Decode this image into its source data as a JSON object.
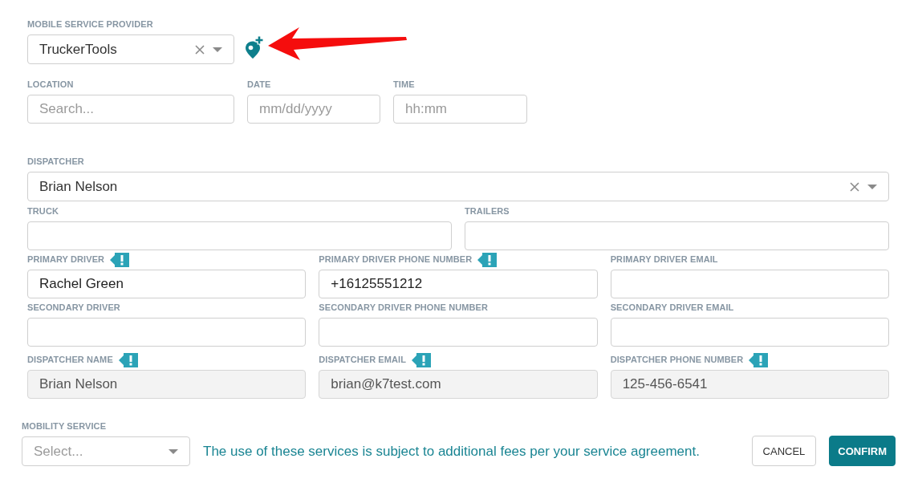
{
  "provider": {
    "label": "MOBILE SERVICE PROVIDER",
    "value": "TruckerTools",
    "clearable": true
  },
  "schedule": [
    {
      "label": "LOCATION",
      "placeholder": "Search..."
    },
    {
      "label": "DATE",
      "placeholder": "mm/dd/yyyy"
    },
    {
      "label": "TIME",
      "placeholder": "hh:mm"
    }
  ],
  "dispatcher": {
    "label": "DISPATCHER",
    "value": "Brian Nelson",
    "clearable": true
  },
  "vehicles": [
    {
      "label": "TRUCK"
    },
    {
      "label": "TRAILERS"
    }
  ],
  "driver_rows": [
    {
      "fields": [
        {
          "label": "PRIMARY DRIVER",
          "value": "Rachel Green",
          "flagged": true,
          "disabled": false
        },
        {
          "label": "PRIMARY DRIVER PHONE NUMBER",
          "value": "+16125551212",
          "flagged": true,
          "disabled": false
        },
        {
          "label": "PRIMARY DRIVER EMAIL",
          "flagged": false,
          "disabled": false
        }
      ]
    },
    {
      "fields": [
        {
          "label": "SECONDARY DRIVER",
          "flagged": false,
          "disabled": false
        },
        {
          "label": "SECONDARY DRIVER PHONE NUMBER",
          "flagged": false,
          "disabled": false
        },
        {
          "label": "SECONDARY DRIVER EMAIL",
          "flagged": false,
          "disabled": false
        }
      ]
    }
  ],
  "dispatcher_contact": [
    {
      "label": "DISPATCHER NAME",
      "value": "Brian Nelson",
      "flagged": true,
      "disabled": true
    },
    {
      "label": "DISPATCHER EMAIL",
      "value": "brian@k7test.com",
      "flagged": true,
      "disabled": true
    },
    {
      "label": "DISPATCHER PHONE NUMBER",
      "value": "125-456-6541",
      "flagged": true,
      "disabled": true
    }
  ],
  "mobility_service": {
    "label": "MOBILITY SERVICE",
    "placeholder": "Select...",
    "clearable": false
  },
  "notice": "The use of these services is subject to additional fees per your service agreement.",
  "buttons": [
    {
      "label": "CANCEL",
      "kind": "secondary"
    },
    {
      "label": "CONFIRM",
      "kind": "primary"
    }
  ]
}
